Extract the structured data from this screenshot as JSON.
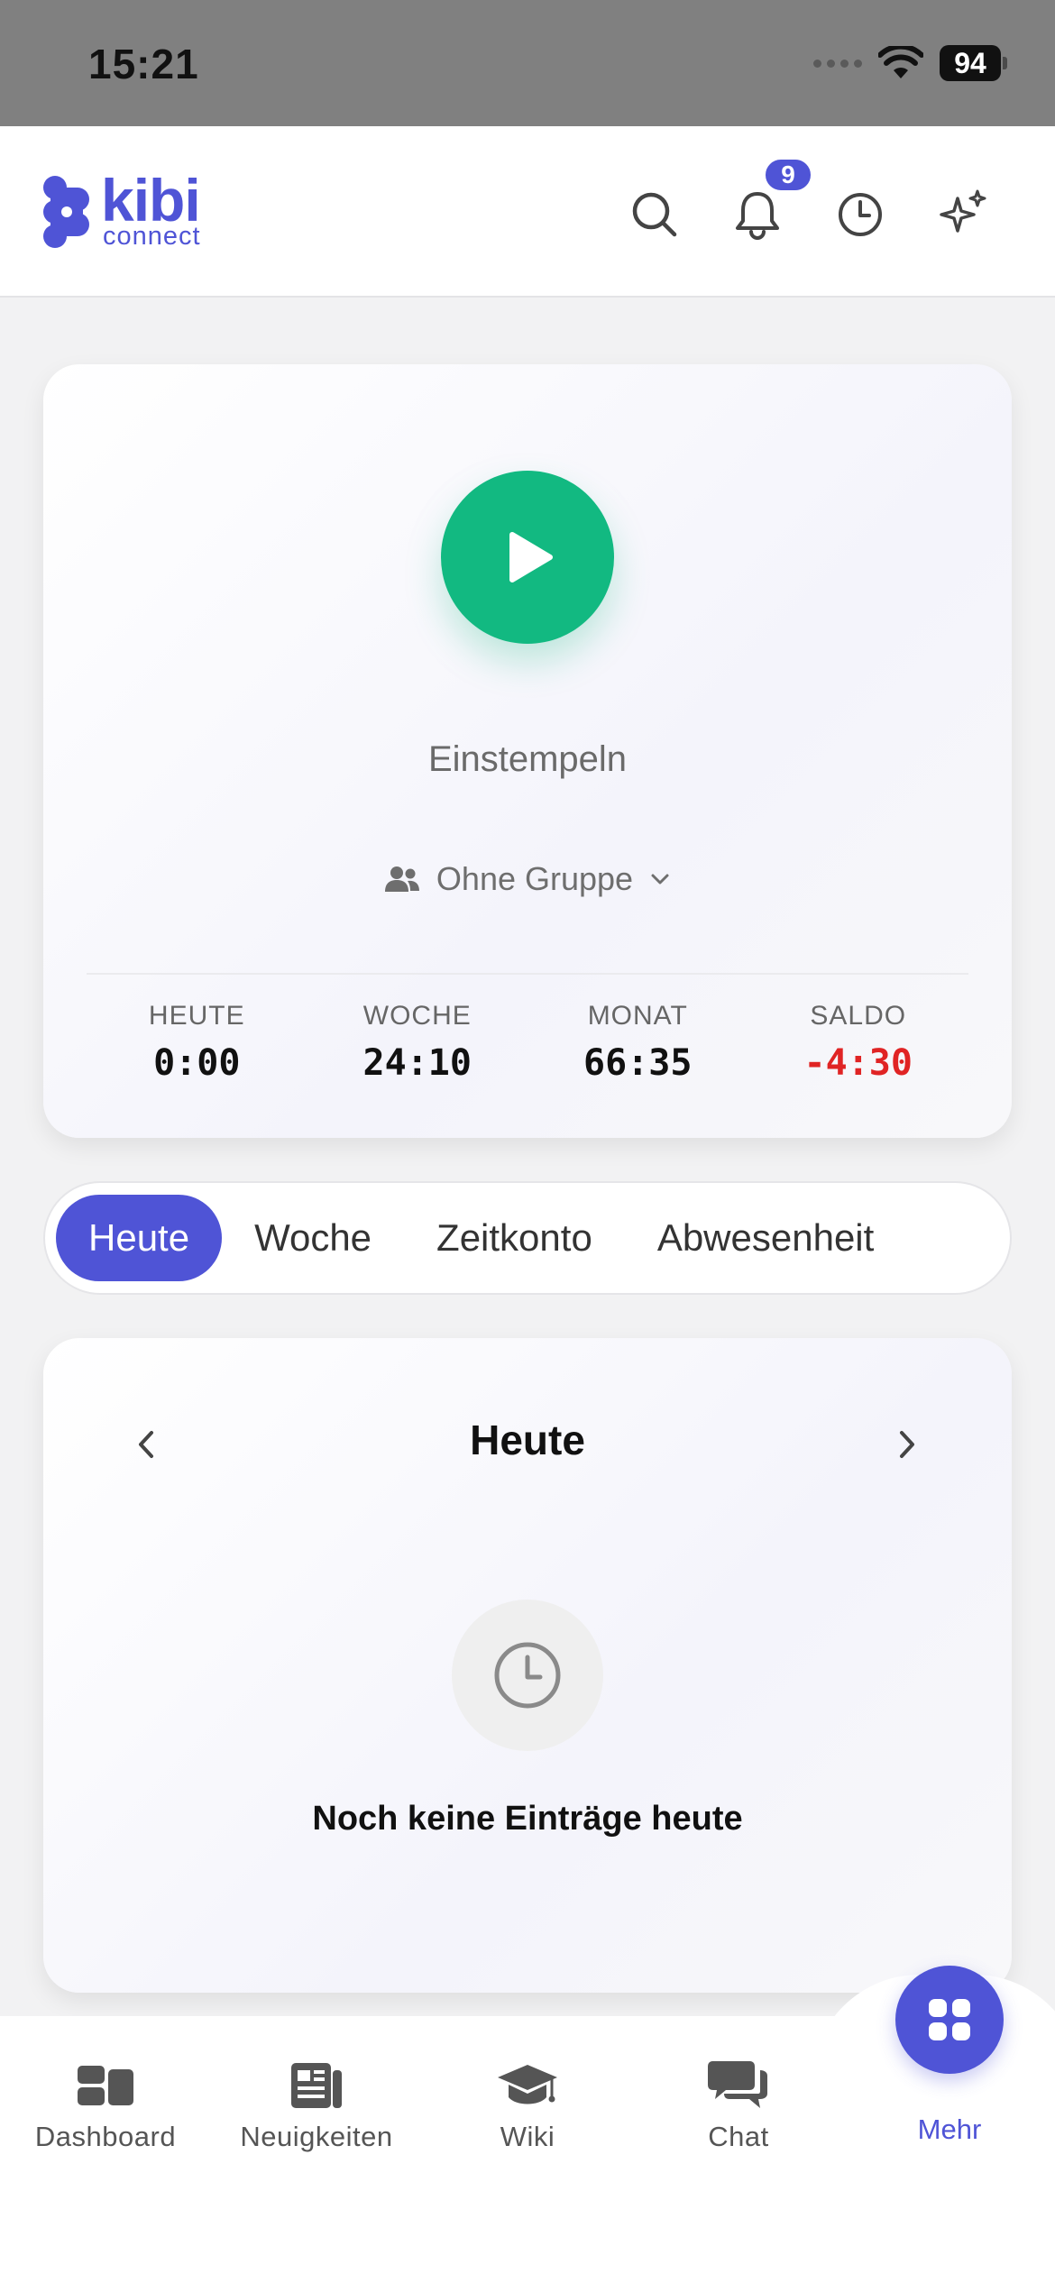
{
  "status_bar": {
    "time": "15:21",
    "battery": "94"
  },
  "header": {
    "logo_primary": "kibi",
    "logo_secondary": "connect",
    "notification_count": "9",
    "icons": [
      "search-icon",
      "bell-icon",
      "clock-icon",
      "sparkles-icon"
    ]
  },
  "clock_card": {
    "action_label": "Einstempeln",
    "group_label": "Ohne Gruppe",
    "stats": [
      {
        "label": "HEUTE",
        "value": "0:00"
      },
      {
        "label": "WOCHE",
        "value": "24:10"
      },
      {
        "label": "MONAT",
        "value": "66:35"
      },
      {
        "label": "SALDO",
        "value": "-4:30"
      }
    ],
    "colors": {
      "play": "#12b981",
      "negative": "#e02424"
    }
  },
  "tabs": [
    {
      "label": "Heute",
      "active": true
    },
    {
      "label": "Woche",
      "active": false
    },
    {
      "label": "Zeitkonto",
      "active": false
    },
    {
      "label": "Abwesenheit",
      "active": false
    }
  ],
  "day_card": {
    "title": "Heute",
    "empty_text": "Noch keine Einträge heute"
  },
  "bottom_nav": {
    "items": [
      {
        "label": "Dashboard",
        "icon": "dashboard-icon"
      },
      {
        "label": "Neuigkeiten",
        "icon": "news-icon"
      },
      {
        "label": "Wiki",
        "icon": "graduation-cap-icon"
      },
      {
        "label": "Chat",
        "icon": "chat-icon"
      },
      {
        "label": "Mehr",
        "icon": "grid-icon",
        "active": true
      }
    ]
  },
  "accent_color": "#4f54d6"
}
